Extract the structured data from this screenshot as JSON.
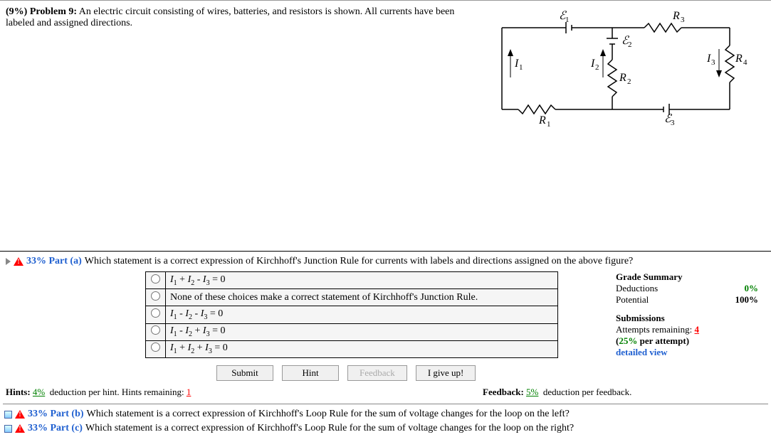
{
  "problem": {
    "weight_label": "(9%)",
    "title": "Problem 9:",
    "description": "An electric circuit consisting of wires, batteries, and resistors is shown. All currents have been labeled and assigned directions."
  },
  "circuit_labels": {
    "E1": "ℰ₁",
    "E2": "ℰ₂",
    "E3": "ℰ₃",
    "R1": "R₁",
    "R2": "R₂",
    "R3": "R₃",
    "R4": "R₄",
    "I1": "I₁",
    "I2": "I₂",
    "I3": "I₃"
  },
  "part_a": {
    "warn": "!",
    "percent": "33%",
    "label": "Part (a)",
    "question": "Which statement is a correct expression of Kirchhoff's Junction Rule for currents with labels and directions assigned on the above figure?",
    "options": [
      "I₁ + I₂ - I₃ = 0",
      "None of these choices make a correct statement of Kirchhoff's Junction Rule.",
      "I₁ - I₂ - I₃ = 0",
      "I₁ - I₂ + I₃ = 0",
      "I₁ + I₂ + I₃ = 0"
    ]
  },
  "grade": {
    "title": "Grade Summary",
    "deductions_label": "Deductions",
    "deductions_val": "0%",
    "potential_label": "Potential",
    "potential_val": "100%",
    "submissions_title": "Submissions",
    "attempts_label": "Attempts remaining:",
    "attempts_num": "4",
    "per_attempt_pct": "25%",
    "per_attempt_sfx": " per attempt)",
    "per_attempt_pfx": "(",
    "detailed": "detailed view"
  },
  "buttons": {
    "submit": "Submit",
    "hint": "Hint",
    "feedback": "Feedback",
    "giveup": "I give up!"
  },
  "hints": {
    "hints_label": "Hints:",
    "hints_pct": "4%",
    "hints_text": "deduction per hint. Hints remaining:",
    "hints_remain": "1",
    "feedback_label": "Feedback:",
    "feedback_pct": "5%",
    "feedback_text": "deduction per feedback."
  },
  "part_b": {
    "percent": "33%",
    "label": "Part (b)",
    "question": "Which statement is a correct expression of Kirchhoff's Loop Rule for the sum of voltage changes for the loop on the left?"
  },
  "part_c": {
    "percent": "33%",
    "label": "Part (c)",
    "question": "Which statement is a correct expression of Kirchhoff's Loop Rule for the sum of voltage changes for the loop on the right?"
  }
}
